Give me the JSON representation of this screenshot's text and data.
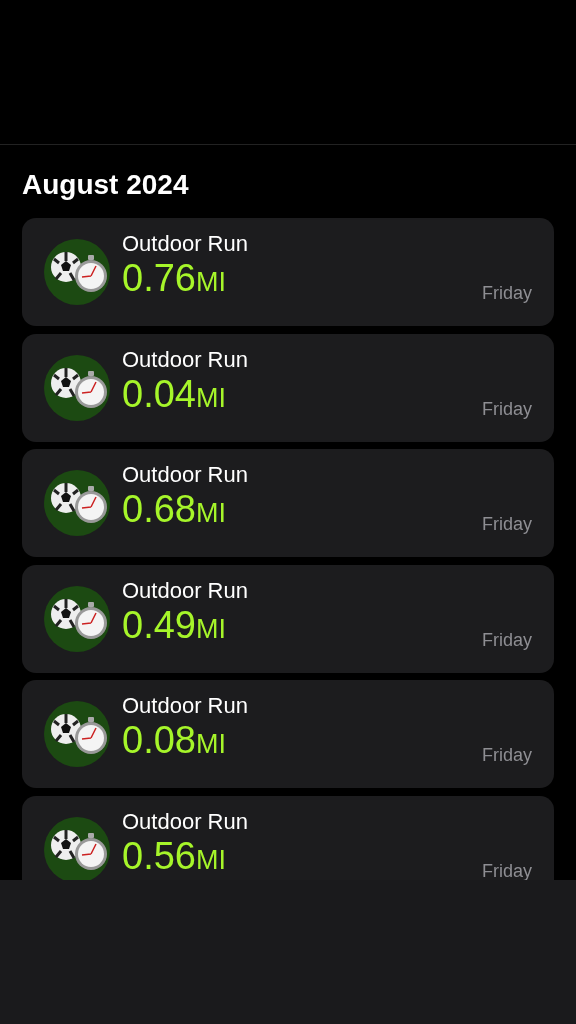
{
  "section_title": "August 2024",
  "workouts": [
    {
      "name": "Outdoor Run",
      "distance": "0.76",
      "unit": "MI",
      "day": "Friday"
    },
    {
      "name": "Outdoor Run",
      "distance": "0.04",
      "unit": "MI",
      "day": "Friday"
    },
    {
      "name": "Outdoor Run",
      "distance": "0.68",
      "unit": "MI",
      "day": "Friday"
    },
    {
      "name": "Outdoor Run",
      "distance": "0.49",
      "unit": "MI",
      "day": "Friday"
    },
    {
      "name": "Outdoor Run",
      "distance": "0.08",
      "unit": "MI",
      "day": "Friday"
    },
    {
      "name": "Outdoor Run",
      "distance": "0.56",
      "unit": "MI",
      "day": "Friday"
    }
  ]
}
